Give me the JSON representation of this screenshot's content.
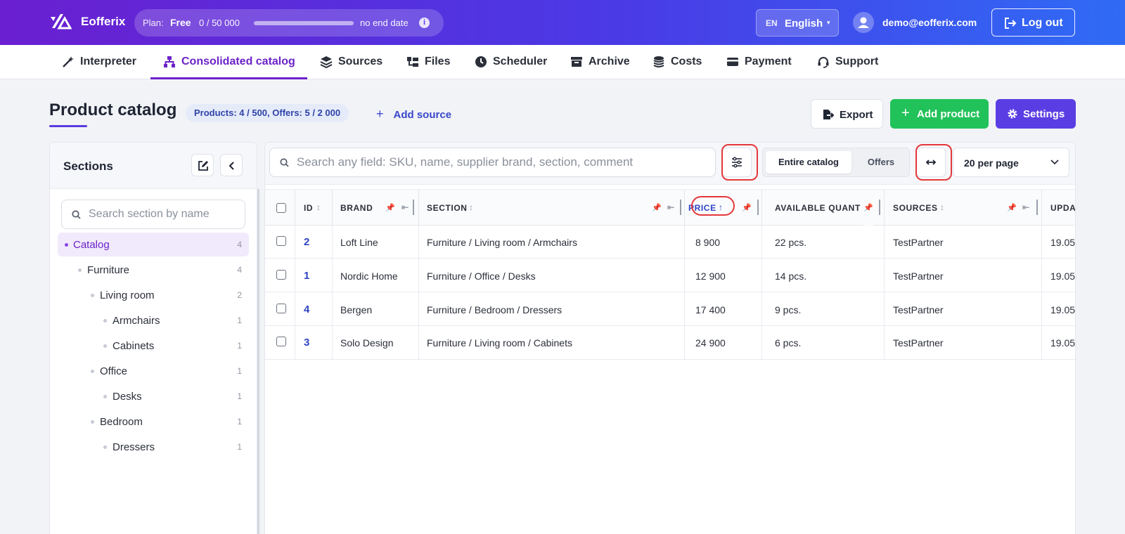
{
  "header": {
    "brand_name": "Eofferix",
    "plan": {
      "label": "Plan:",
      "value": "Free",
      "usage": "0 / 50 000",
      "usage_fraction": 0.0,
      "end_date": "no end date",
      "info_glyph": "i"
    },
    "language": {
      "code": "EN",
      "name": "English",
      "caret": "▾"
    },
    "user_email": "demo@eofferix.com",
    "logout_label": "Log out",
    "colors": {
      "gradient_start": "#6a1fd0",
      "gradient_end": "#2f6bf5"
    }
  },
  "nav": {
    "items": [
      {
        "label": "Interpreter",
        "icon": "magic-wand-icon"
      },
      {
        "label": "Consolidated catalog",
        "icon": "sitemap-icon",
        "active": true
      },
      {
        "label": "Sources",
        "icon": "layers-icon"
      },
      {
        "label": "Files",
        "icon": "folder-tree-icon"
      },
      {
        "label": "Scheduler",
        "icon": "clock-icon"
      },
      {
        "label": "Archive",
        "icon": "archive-box-icon"
      },
      {
        "label": "Costs",
        "icon": "coins-icon"
      },
      {
        "label": "Payment",
        "icon": "credit-card-icon"
      },
      {
        "label": "Support",
        "icon": "headset-icon"
      }
    ]
  },
  "page": {
    "title": "Product catalog",
    "counts": "Products: 4 / 500, Offers: 5 / 2 000",
    "add_source_plus": "+",
    "add_source_label": "Add source",
    "export_label": "Export",
    "add_product_plus": "+",
    "add_product_label": "Add product",
    "settings_label": "Settings"
  },
  "sidebar": {
    "title": "Sections",
    "search_placeholder": "Search section by name",
    "tree": [
      {
        "label": "Catalog",
        "count": "4",
        "level": 0,
        "active": true
      },
      {
        "label": "Furniture",
        "count": "4",
        "level": 1
      },
      {
        "label": "Living room",
        "count": "2",
        "level": 2
      },
      {
        "label": "Armchairs",
        "count": "1",
        "level": 3
      },
      {
        "label": "Cabinets",
        "count": "1",
        "level": 3
      },
      {
        "label": "Office",
        "count": "1",
        "level": 2
      },
      {
        "label": "Desks",
        "count": "1",
        "level": 3
      },
      {
        "label": "Bedroom",
        "count": "1",
        "level": 2
      },
      {
        "label": "Dressers",
        "count": "1",
        "level": 3
      }
    ]
  },
  "toolbar": {
    "search_placeholder": "Search any field: SKU, name, supplier brand, section, comment",
    "scope_options": [
      "Entire catalog",
      "Offers"
    ],
    "scope_selected": "Entire catalog",
    "per_page": "20 per page"
  },
  "table": {
    "columns": {
      "id": "ID",
      "brand": "BRAND",
      "section": "SECTION",
      "price": "PRICE",
      "quantity": "AVAILABLE QUANT",
      "sources": "SOURCES",
      "updated": "UPDA"
    },
    "sort_glyph": "↕",
    "sort_asc_glyph": "↑",
    "pin_glyph": "📌",
    "pin_left_glyph": "⇤",
    "rows": [
      {
        "id": "2",
        "brand": "Loft Line",
        "section": "Furniture / Living room / Armchairs",
        "price": "8 900",
        "quantity": "22 pcs.",
        "sources": "TestPartner",
        "updated": "19.05"
      },
      {
        "id": "1",
        "brand": "Nordic Home",
        "section": "Furniture / Office / Desks",
        "price": "12 900",
        "quantity": "14 pcs.",
        "sources": "TestPartner",
        "updated": "19.05"
      },
      {
        "id": "4",
        "brand": "Bergen",
        "section": "Furniture / Bedroom / Dressers",
        "price": "17 400",
        "quantity": "9 pcs.",
        "sources": "TestPartner",
        "updated": "19.05"
      },
      {
        "id": "3",
        "brand": "Solo Design",
        "section": "Furniture / Living room / Cabinets",
        "price": "24 900",
        "quantity": "6 pcs.",
        "sources": "TestPartner",
        "updated": "19.05"
      }
    ]
  },
  "colors": {
    "accent_purple": "#6b22c9",
    "green": "#22c25a",
    "violet": "#5b3ee3",
    "link_blue": "#2e44c2",
    "highlight_red": "#e5383b"
  }
}
